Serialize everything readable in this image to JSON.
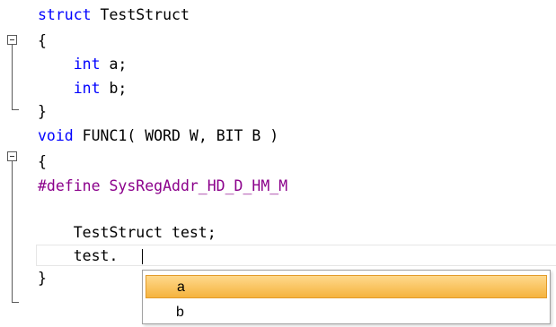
{
  "editor": {
    "lines": [
      [
        {
          "text": "struct",
          "cls": "kw"
        },
        {
          "text": " TestStruct",
          "cls": ""
        }
      ],
      [
        {
          "text": "{",
          "cls": ""
        }
      ],
      [
        {
          "text": "    int",
          "cls": "kw"
        },
        {
          "text": " a;",
          "cls": ""
        }
      ],
      [
        {
          "text": "    int",
          "cls": "kw"
        },
        {
          "text": " b;",
          "cls": ""
        }
      ],
      [
        {
          "text": "}",
          "cls": ""
        }
      ],
      [
        {
          "text": "void",
          "cls": "kw"
        },
        {
          "text": " FUNC1( WORD W, BIT B )",
          "cls": ""
        }
      ],
      [
        {
          "text": "{",
          "cls": ""
        }
      ],
      [
        {
          "text": "#define SysRegAddr_HD_D_HM_M",
          "cls": "pp"
        }
      ],
      [
        {
          "text": "",
          "cls": ""
        }
      ],
      [
        {
          "text": "    TestStruct test;",
          "cls": ""
        }
      ],
      [
        {
          "text": "    test.",
          "cls": ""
        }
      ],
      [
        {
          "text": "}",
          "cls": ""
        }
      ]
    ]
  },
  "completion": {
    "items": [
      {
        "label": "a",
        "selected": true
      },
      {
        "label": "b",
        "selected": false
      }
    ]
  },
  "colors": {
    "keyword": "#0000ff",
    "preprocessor": "#8b008b",
    "selection": "#f5b33e"
  }
}
